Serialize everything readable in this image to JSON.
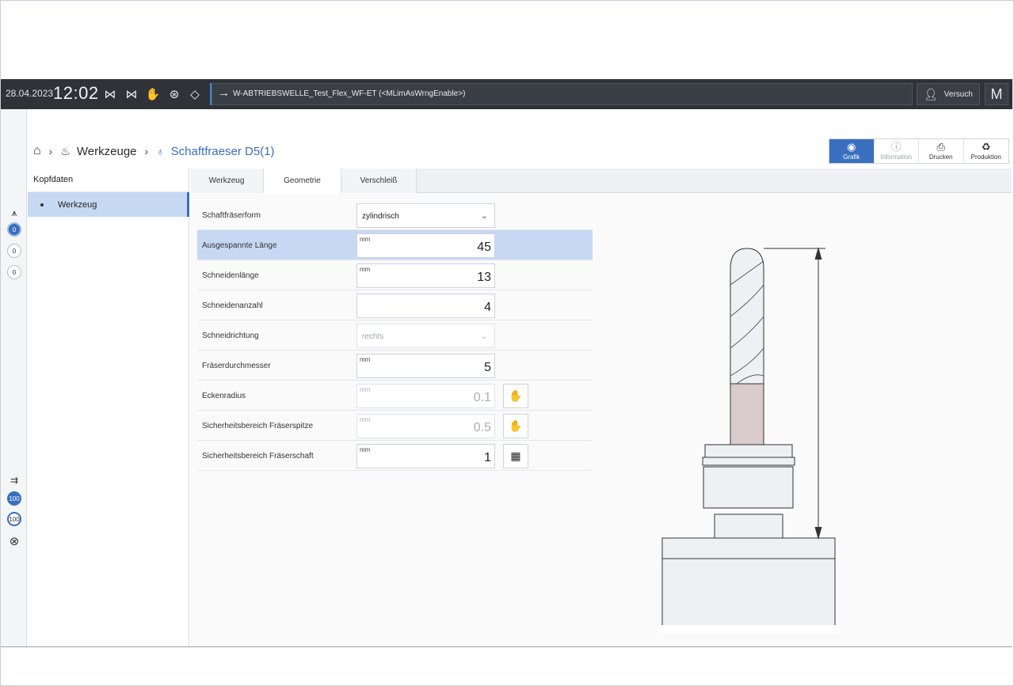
{
  "topbar": {
    "date": "28.04.2023",
    "time": "12:02",
    "program": "W-ABTRIEBSWELLE_Test_Flex_WF-ET (<MLimAsWrngEnable>)",
    "user_label": "Versuch",
    "menu_label": "M"
  },
  "rail": {
    "badges_top": [
      "0",
      "0",
      "0"
    ],
    "badges_bottom": [
      "100",
      "100"
    ]
  },
  "breadcrumb": {
    "level1": "Werkzeuge",
    "level2": "Schaftfraeser D5(1)"
  },
  "toolbar": {
    "grafik": "Grafik",
    "information": "Information",
    "drucken": "Drucken",
    "produktion": "Produktion"
  },
  "left_panel": {
    "header": "Kopfdaten",
    "item": "Werkzeug"
  },
  "tabs": [
    "Werkzeug",
    "Geometrie",
    "Verschleiß"
  ],
  "form": {
    "schaftfraeserform": {
      "label": "Schaftfräserform",
      "value": "zylindrisch"
    },
    "ausgespannte_laenge": {
      "label": "Ausgespannte Länge",
      "unit": "mm",
      "value": "45"
    },
    "schneidenlaenge": {
      "label": "Schneidenlänge",
      "unit": "mm",
      "value": "13"
    },
    "schneidenanzahl": {
      "label": "Schneidenanzahl",
      "value": "4"
    },
    "schneidrichtung": {
      "label": "Schneidrichtung",
      "value": "rechts"
    },
    "fraeserdurchmesser": {
      "label": "Fräserdurchmesser",
      "unit": "mm",
      "value": "5"
    },
    "eckenradius": {
      "label": "Eckenradius",
      "unit": "mm",
      "value": "0.1"
    },
    "sicherheitsbereich_spitze": {
      "label": "Sicherheitsbereich Fräserspitze",
      "unit": "mm",
      "value": "0.5"
    },
    "sicherheitsbereich_schaft": {
      "label": "Sicherheitsbereich Fräserschaft",
      "unit": "mm",
      "value": "1"
    }
  },
  "colors": {
    "accent": "#3a6fbf",
    "highlight": "#c7d8f3",
    "topbar": "#2f3338"
  }
}
